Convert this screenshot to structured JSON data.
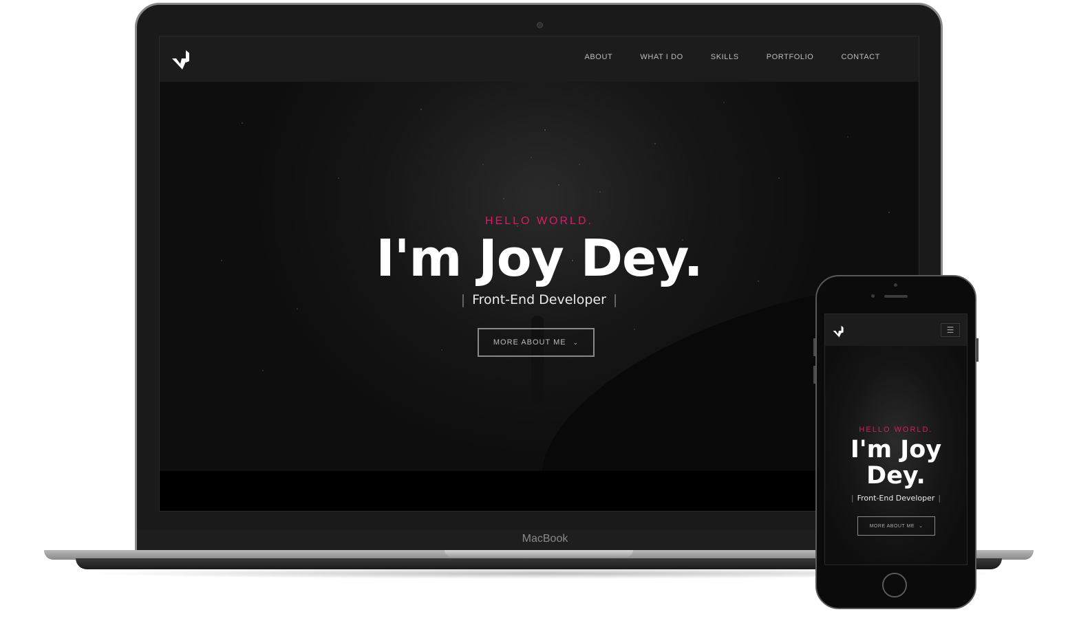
{
  "laptop": {
    "brand_label": "MacBook",
    "site": {
      "nav": {
        "links": [
          "ABOUT",
          "WHAT I DO",
          "SKILLS",
          "PORTFOLIO",
          "CONTACT"
        ]
      },
      "hero": {
        "kicker": "HELLO WORLD.",
        "title": "I'm Joy Dey.",
        "subtitle": "Front-End Developer",
        "subtitle_bar": "|",
        "button_label": "MORE ABOUT ME",
        "button_icon": "chevron-down-icon",
        "chevron": "⌄"
      }
    }
  },
  "phone": {
    "site": {
      "menu_icon": "hamburger-icon",
      "menu_glyph": "☰",
      "hero": {
        "kicker": "HELLO WORLD.",
        "title_line1": "I'm Joy",
        "title_line2": "Dey.",
        "subtitle": "Front-End Developer",
        "subtitle_bar": "|",
        "button_label": "MORE ABOUT ME",
        "chevron": "⌄"
      }
    }
  },
  "colors": {
    "accent": "#e0176b",
    "background": "#000000",
    "navbar": "#1c1c1c"
  }
}
